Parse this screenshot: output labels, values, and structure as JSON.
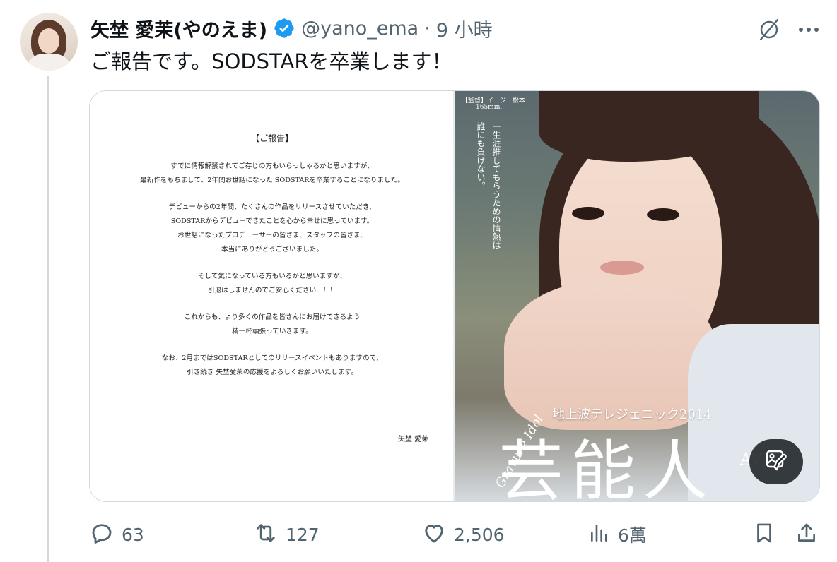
{
  "tweet": {
    "display_name": "矢埜 愛茉(やのえま)",
    "handle": "@yano_ema",
    "separator": "·",
    "time": "9 小時",
    "text": "ご報告です。SODSTARを卒業します！"
  },
  "media": {
    "letter": {
      "title": "【ご報告】",
      "paragraphs": [
        [
          "すでに情報解禁されてご存じの方もいらっしゃるかと思いますが、",
          "最新作をもちまして、2年間お世話になった SODSTARを卒業することになりました。"
        ],
        [
          "デビューからの2年間、たくさんの作品をリリースさせていただき、",
          "SODSTARからデビューできたことを心から幸せに思っています。",
          "お世話になったプロデューサーの皆さま、スタッフの皆さま、",
          "本当にありがとうございました。"
        ],
        [
          "そして気になっている方もいるかと思いますが、",
          "引退はしませんのでご安心ください…！！"
        ],
        [
          "これからも、より多くの作品を皆さんにお届けできるよう",
          "精一杯頑張っていきます。"
        ],
        [
          "なお、2月まではSODSTARとしてのリリースイベントもありますので、",
          "引き続き 矢埜愛茉の応援をよろしくお願いいたします。"
        ]
      ],
      "signature": "矢埜 愛茉"
    },
    "cover": {
      "label": "【監督】イージー松本",
      "minutes": "165min.",
      "tagline": "一生涯推してもらうための情熱は誰にも負けない。",
      "subtitle": "地上波テレジェニック2014",
      "script": "Gravure Idol",
      "big_text": "芸能人",
      "corner": "AV"
    }
  },
  "actions": {
    "replies": "63",
    "retweets": "127",
    "likes": "2,506",
    "views": "6萬"
  },
  "colors": {
    "verified": "#1d9bf0",
    "muted": "#536471",
    "thread_line": "#cfd9de"
  },
  "icons": [
    "verified-badge-icon",
    "grok-icon",
    "more-icon",
    "edit-image-icon",
    "reply-icon",
    "retweet-icon",
    "like-icon",
    "views-icon",
    "bookmark-icon",
    "share-icon"
  ]
}
